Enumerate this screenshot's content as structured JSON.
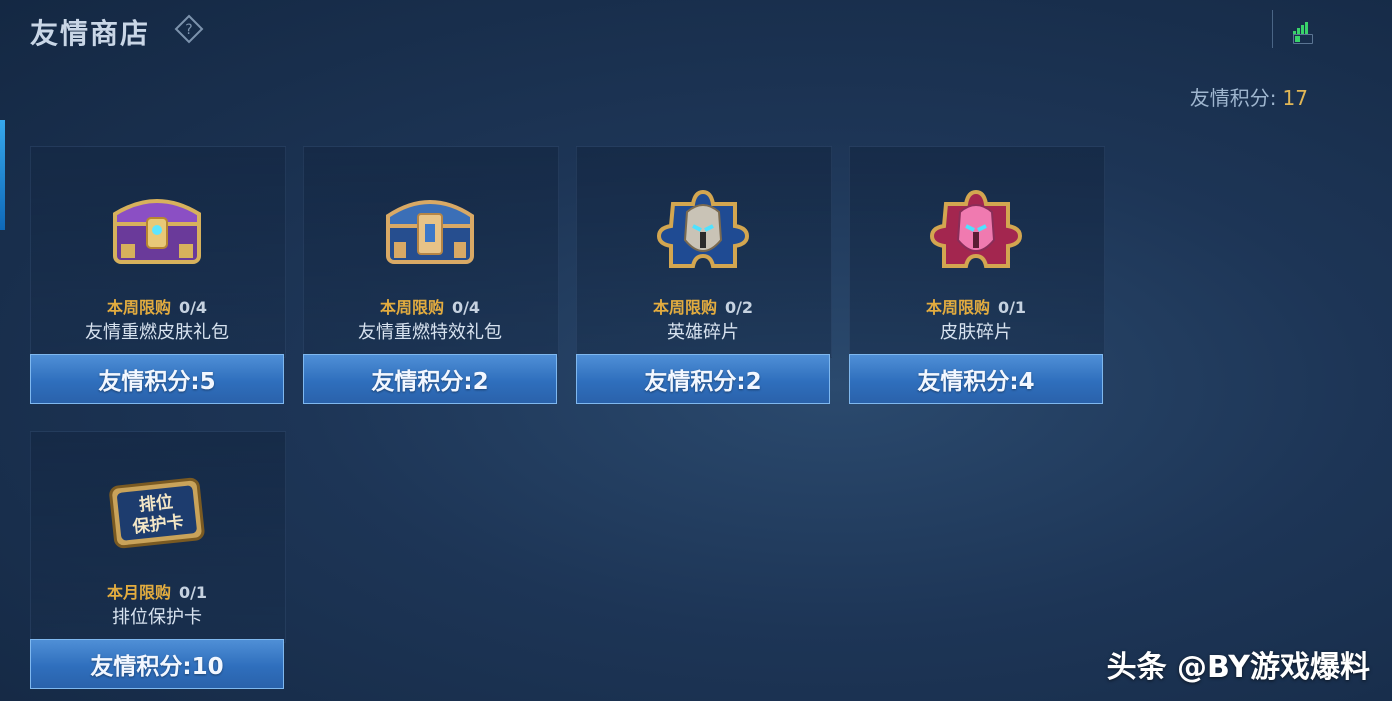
{
  "header": {
    "title": "友情商店",
    "help_icon": "question-diamond-icon"
  },
  "status": {
    "signal_icon": "signal-bars-icon",
    "battery_icon": "battery-icon"
  },
  "points": {
    "label": "友情积分:",
    "value": "17"
  },
  "items": [
    {
      "limit_label": "本周限购",
      "limit_count": "0/4",
      "name": "友情重燃皮肤礼包",
      "price": "友情积分:5",
      "icon": "purple-treasure-chest-icon"
    },
    {
      "limit_label": "本周限购",
      "limit_count": "0/4",
      "name": "友情重燃特效礼包",
      "price": "友情积分:2",
      "icon": "blue-treasure-chest-icon"
    },
    {
      "limit_label": "本周限购",
      "limit_count": "0/2",
      "name": "英雄碎片",
      "price": "友情积分:2",
      "icon": "hero-fragment-icon"
    },
    {
      "limit_label": "本周限购",
      "limit_count": "0/1",
      "name": "皮肤碎片",
      "price": "友情积分:4",
      "icon": "skin-fragment-icon"
    },
    {
      "limit_label": "本月限购",
      "limit_count": "0/1",
      "name": "排位保护卡",
      "price": "友情积分:10",
      "icon": "rank-protection-card-icon",
      "card_text_line1": "排位",
      "card_text_line2": "保护卡"
    }
  ],
  "watermark": "头条 @BY游戏爆料",
  "colors": {
    "accent_gold": "#e3ac3f",
    "button_blue": "#2f6fbd",
    "background": "#1d3556"
  }
}
